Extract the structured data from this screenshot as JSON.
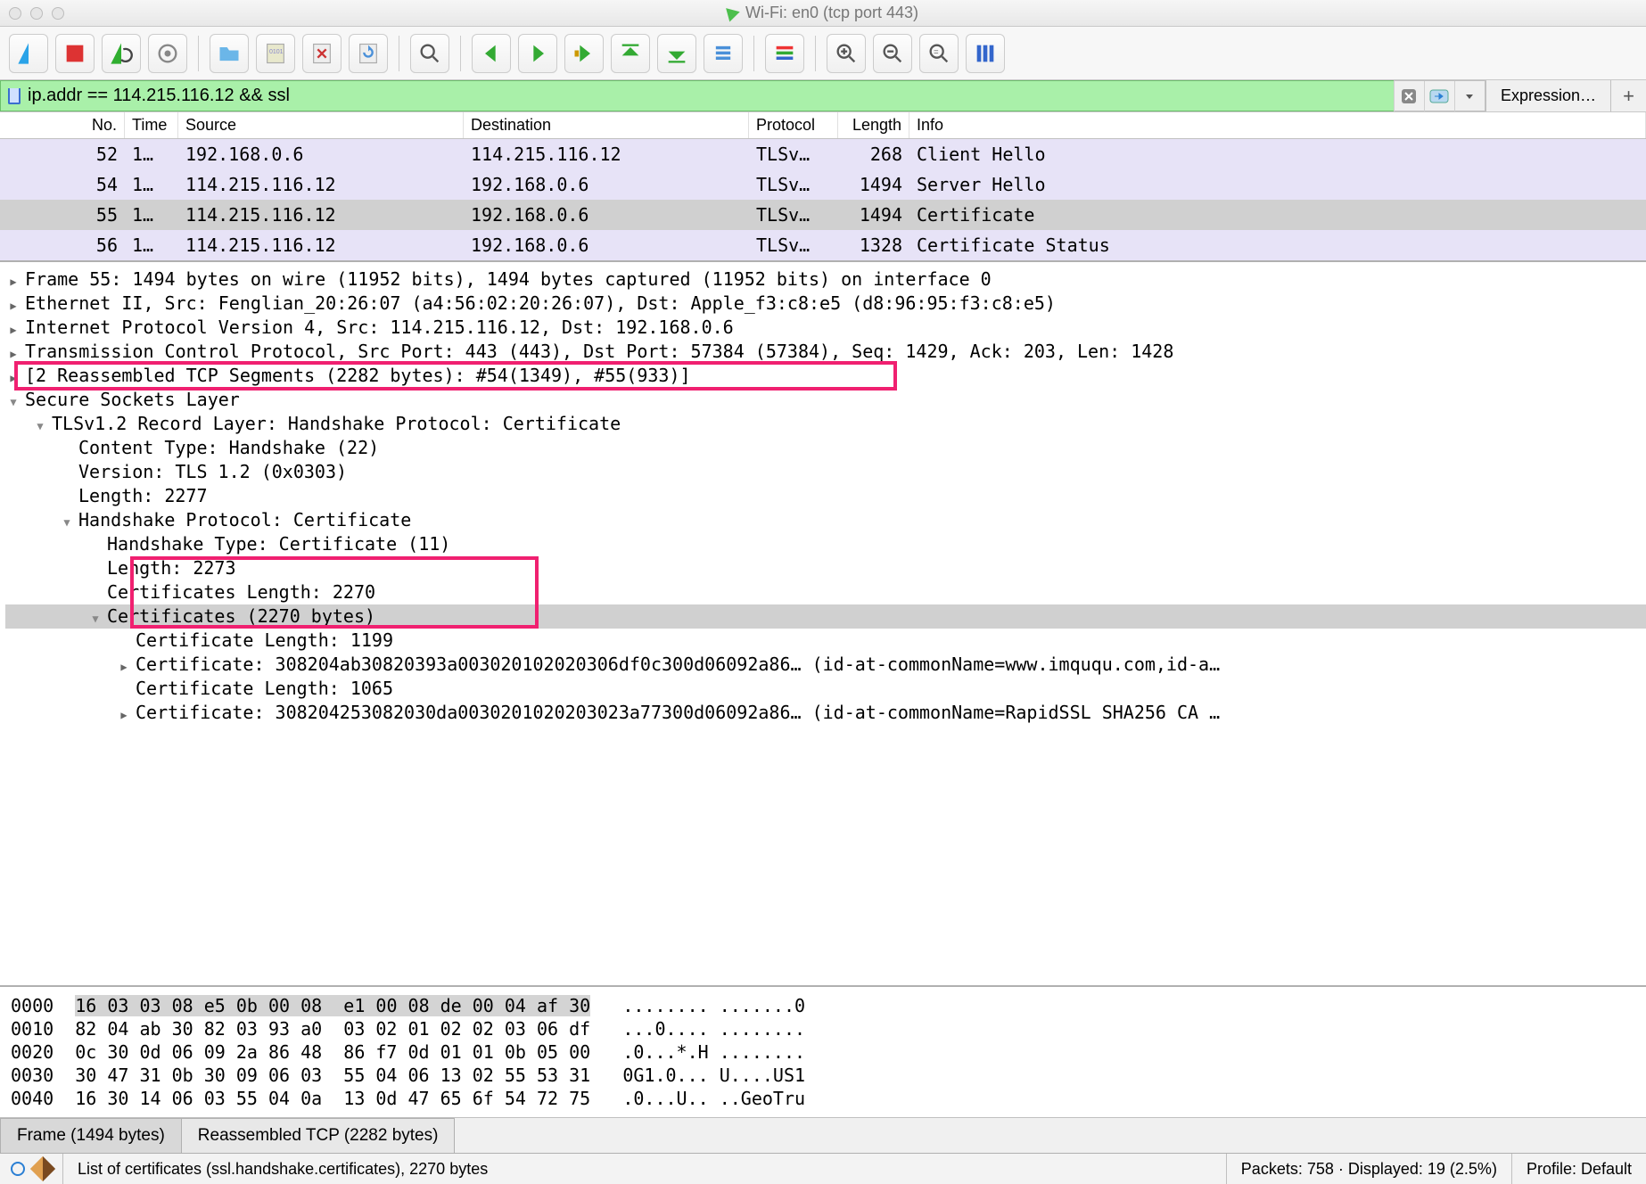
{
  "window": {
    "title": "Wi-Fi: en0 (tcp port 443)"
  },
  "filter": {
    "text": "ip.addr == 114.215.116.12 && ssl",
    "expression_label": "Expression…"
  },
  "packet_list": {
    "headers": {
      "no": "No.",
      "time": "Time",
      "src": "Source",
      "dst": "Destination",
      "proto": "Protocol",
      "len": "Length",
      "info": "Info"
    },
    "rows": [
      {
        "no": "52",
        "time": "1…",
        "src": "192.168.0.6",
        "dst": "114.215.116.12",
        "proto": "TLSv…",
        "len": "268",
        "info": "Client Hello",
        "odd": true
      },
      {
        "no": "54",
        "time": "1…",
        "src": "114.215.116.12",
        "dst": "192.168.0.6",
        "proto": "TLSv…",
        "len": "1494",
        "info": "Server Hello",
        "odd": true
      },
      {
        "no": "55",
        "time": "1…",
        "src": "114.215.116.12",
        "dst": "192.168.0.6",
        "proto": "TLSv…",
        "len": "1494",
        "info": "Certificate",
        "sel": true
      },
      {
        "no": "56",
        "time": "1…",
        "src": "114.215.116.12",
        "dst": "192.168.0.6",
        "proto": "TLSv…",
        "len": "1328",
        "info": "Certificate Status",
        "odd": true
      }
    ]
  },
  "details": {
    "frame": "Frame 55: 1494 bytes on wire (11952 bits), 1494 bytes captured (11952 bits) on interface 0",
    "eth": "Ethernet II, Src: Fenglian_20:26:07 (a4:56:02:20:26:07), Dst: Apple_f3:c8:e5 (d8:96:95:f3:c8:e5)",
    "ip": "Internet Protocol Version 4, Src: 114.215.116.12, Dst: 192.168.0.6",
    "tcp": "Transmission Control Protocol, Src Port: 443 (443), Dst Port: 57384 (57384), Seq: 1429, Ack: 203, Len: 1428",
    "reasm": "[2 Reassembled TCP Segments (2282 bytes): #54(1349), #55(933)]",
    "ssl": "Secure Sockets Layer",
    "tls_rec": "TLSv1.2 Record Layer: Handshake Protocol: Certificate",
    "ct": "Content Type: Handshake (22)",
    "ver": "Version: TLS 1.2 (0x0303)",
    "len0": "Length: 2277",
    "hp": "Handshake Protocol: Certificate",
    "ht": "Handshake Type: Certificate (11)",
    "len1": "Length: 2273",
    "clen": "Certificates Length: 2270",
    "certs": "Certificates (2270 bytes)",
    "cl1": "Certificate Length: 1199",
    "c1": "Certificate: 308204ab30820393a003020102020306df0c300d06092a86… (id-at-commonName=www.imququ.com,id-a…",
    "cl2": "Certificate Length: 1065",
    "c2": "Certificate: 308204253082030da0030201020203023a77300d06092a86… (id-at-commonName=RapidSSL SHA256 CA …"
  },
  "hex": {
    "lines": [
      {
        "off": "0000",
        "hex": "16 03 03 08 e5 0b 00 08  e1 00 08 de 00 04 af 30",
        "asc": "........ .......0",
        "hl": true
      },
      {
        "off": "0010",
        "hex": "82 04 ab 30 82 03 93 a0  03 02 01 02 02 03 06 df",
        "asc": "...0.... ........"
      },
      {
        "off": "0020",
        "hex": "0c 30 0d 06 09 2a 86 48  86 f7 0d 01 01 0b 05 00",
        "asc": ".0...*.H ........"
      },
      {
        "off": "0030",
        "hex": "30 47 31 0b 30 09 06 03  55 04 06 13 02 55 53 31",
        "asc": "0G1.0... U....US1"
      },
      {
        "off": "0040",
        "hex": "16 30 14 06 03 55 04 0a  13 0d 47 65 6f 54 72 75",
        "asc": ".0...U.. ..GeoTru"
      }
    ]
  },
  "tabs": {
    "t1": "Frame (1494 bytes)",
    "t2": "Reassembled TCP (2282 bytes)"
  },
  "status": {
    "left": "List of certificates (ssl.handshake.certificates), 2270 bytes",
    "packets": "Packets: 758 · Displayed: 19 (2.5%)",
    "profile": "Profile: Default"
  }
}
